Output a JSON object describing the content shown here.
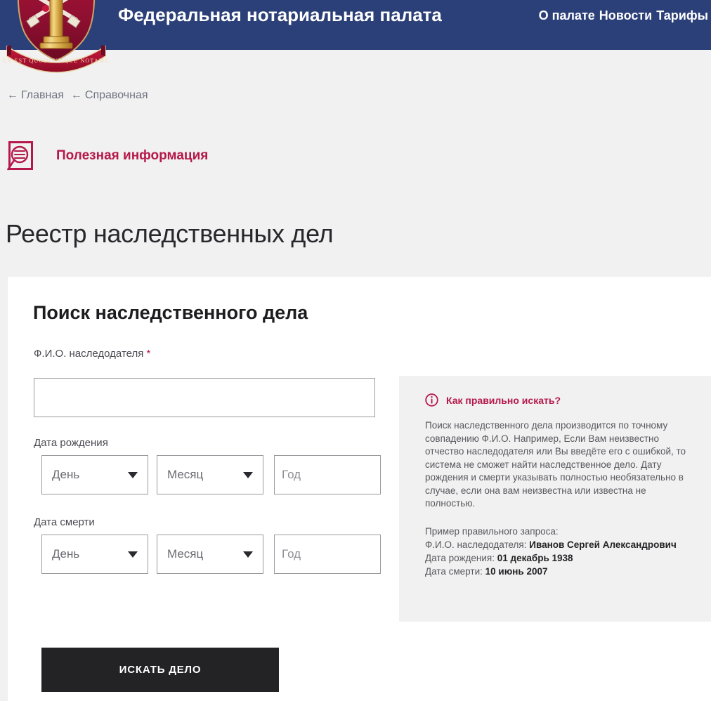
{
  "header": {
    "title": "Федеральная нотариальная палата",
    "logo_icon": "notary-emblem-icon",
    "nav": [
      {
        "label": "О палате"
      },
      {
        "label": "Новости"
      },
      {
        "label": "Тарифы"
      }
    ]
  },
  "breadcrumb": {
    "arrow": "←",
    "items": [
      {
        "label": "Главная"
      },
      {
        "label": "Справочная"
      }
    ]
  },
  "useful_info": {
    "icon": "document-search-icon",
    "label": "Полезная информация"
  },
  "page": {
    "title": "Реестр наследственных дел"
  },
  "form": {
    "title": "Поиск наследственного дела",
    "fio": {
      "label": "Ф.И.О. наследодателя",
      "required_mark": "*",
      "value": "",
      "placeholder": ""
    },
    "birth_date": {
      "label": "Дата рождения",
      "day": "День",
      "month": "Месяц",
      "year_placeholder": "Год",
      "year_value": ""
    },
    "death_date": {
      "label": "Дата смерти",
      "day": "День",
      "month": "Месяц",
      "year_placeholder": "Год",
      "year_value": ""
    },
    "submit_label": "ИСКАТЬ ДЕЛО"
  },
  "info_panel": {
    "icon": "info-circle-icon",
    "heading": "Как правильно искать?",
    "body": "Поиск наследственного дела производится по точному совпадению Ф.И.О. Например, Если Вам неизвестно отчество наследодателя или Вы введёте его с ошибкой, то система не сможет найти наследственное дело. Дату рождения и смерти указывать полностью необязательно в случае, если она вам неизвестна или известна не полностью.",
    "example_title": "Пример правильного запроса:",
    "example_fio_label": "Ф.И.О. наследодателя:",
    "example_fio_value": "Иванов Сергей Александрович",
    "example_birth_label": "Дата рождения:",
    "example_birth_value": "01 декабрь 1938",
    "example_death_label": "Дата смерти:",
    "example_death_value": "10 июнь 2007"
  },
  "colors": {
    "header_navy": "#2b3f78",
    "accent_crimson": "#b5194b",
    "button_dark": "#232326",
    "page_bg": "#f1f1f1",
    "panel_bg": "#f1f1f1"
  }
}
